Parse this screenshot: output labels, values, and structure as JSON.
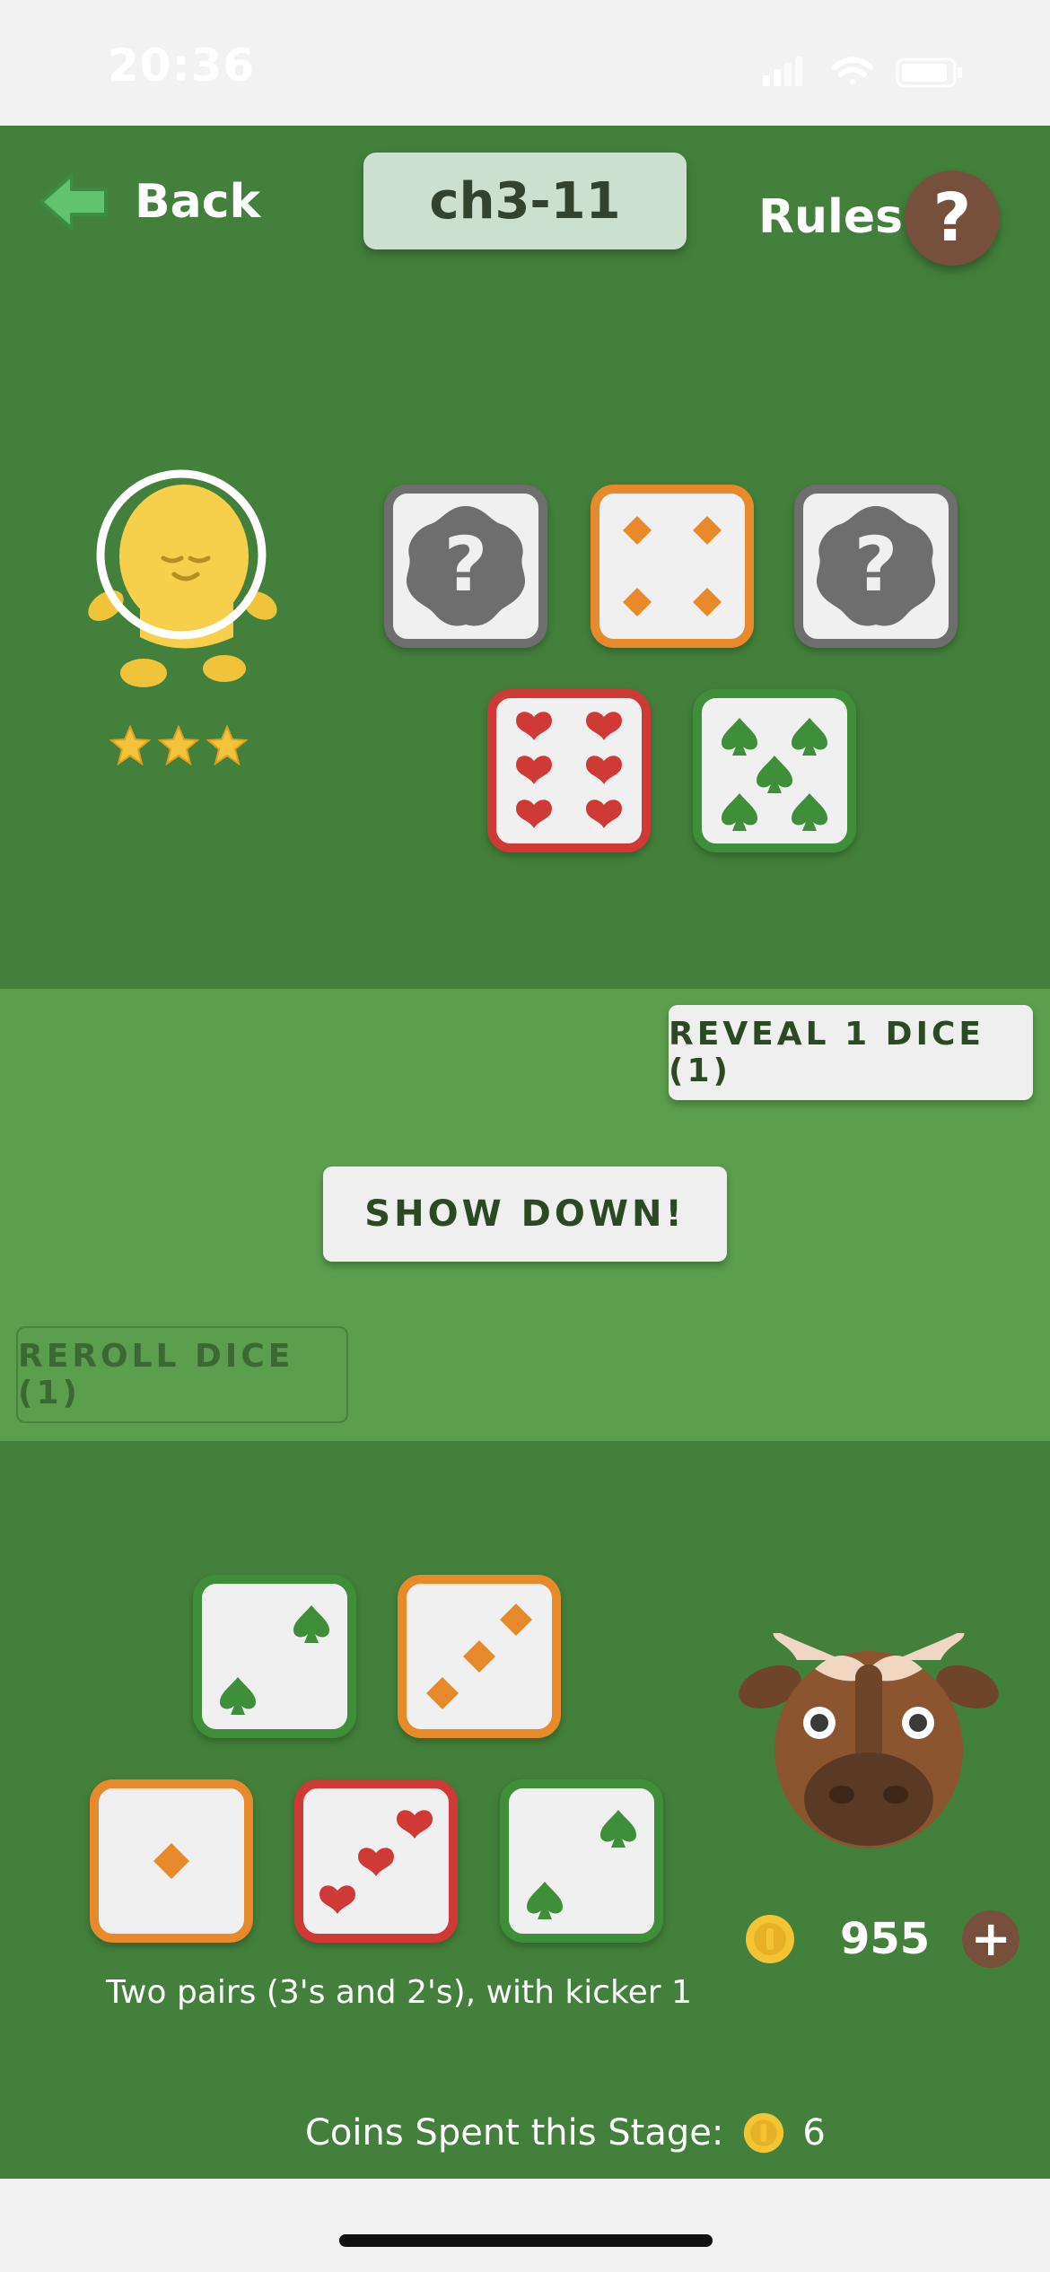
{
  "status_bar": {
    "time": "20:36"
  },
  "header": {
    "back_label": "Back",
    "level": "ch3-11",
    "rules_label": "Rules",
    "rules_icon": "?"
  },
  "opponent": {
    "name_icon": "yellow-blob-character",
    "stars": 3,
    "dice": [
      {
        "state": "hidden",
        "icon": "?"
      },
      {
        "state": "shown",
        "suit": "diamond",
        "value": 4,
        "color": "#e88a2c"
      },
      {
        "state": "hidden",
        "icon": "?"
      },
      {
        "state": "shown",
        "suit": "heart",
        "value": 6,
        "color": "#cf3a37"
      },
      {
        "state": "shown",
        "suit": "spade",
        "value": 5,
        "color": "#3f8f3a"
      }
    ]
  },
  "actions": {
    "reveal_label": "REVEAL 1 DICE (1)",
    "showdown_label": "SHOW DOWN!",
    "reroll_label": "REROLL DICE (1)"
  },
  "player": {
    "avatar_icon": "bull-character",
    "coins": "955",
    "add_coins_icon": "+",
    "dice": [
      {
        "suit": "spade",
        "value": 2,
        "color": "#3f8f3a"
      },
      {
        "suit": "diamond",
        "value": 3,
        "color": "#e88a2c"
      },
      {
        "suit": "diamond",
        "value": 1,
        "color": "#e88a2c"
      },
      {
        "suit": "heart",
        "value": 3,
        "color": "#cf3a37"
      },
      {
        "suit": "spade",
        "value": 2,
        "color": "#3f8f3a"
      }
    ],
    "hand_description": "Two pairs (3's and 2's), with kicker 1"
  },
  "footer": {
    "coins_spent_label": "Coins Spent this Stage:",
    "coins_spent_value": "6"
  },
  "colors": {
    "felt_dark": "#43803b",
    "felt_light": "#5b9e4d",
    "brown_button": "#76503b"
  }
}
